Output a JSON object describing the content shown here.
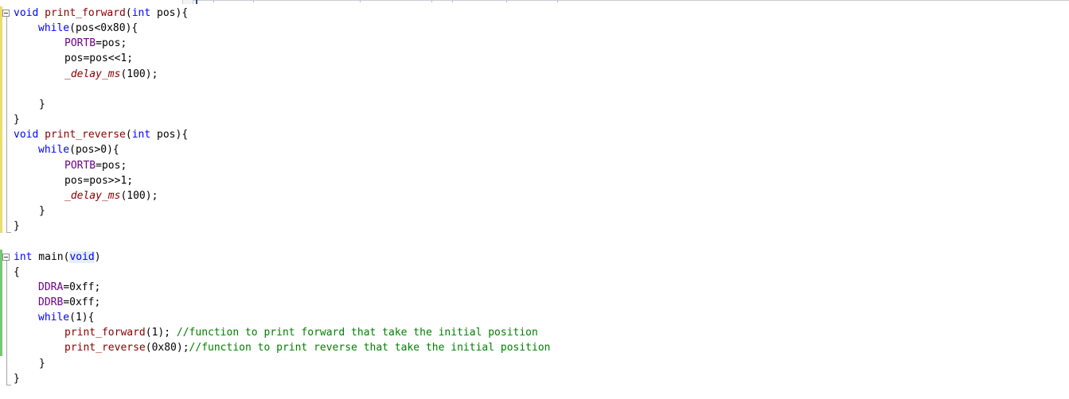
{
  "editor": {
    "fn_forward": {
      "sig_kw": "void",
      "sig_name": "print_forward",
      "sig_rest_open": "(",
      "sig_type": "int",
      "sig_param": " pos){",
      "while_kw": "while",
      "while_cond": "(pos<0x80){",
      "portb_name": "PORTB",
      "portb_rest": "=pos;",
      "shift_line": "pos=pos<<1;",
      "delay_name": "_delay_ms",
      "delay_args": "(100);",
      "close_inner": "}",
      "close_outer": "}"
    },
    "fn_reverse": {
      "sig_kw": "void",
      "sig_name": "print_reverse",
      "sig_rest_open": "(",
      "sig_type": "int",
      "sig_param": " pos){",
      "while_kw": "while",
      "while_cond": "(pos>0){",
      "portb_name": "PORTB",
      "portb_rest": "=pos;",
      "shift_line": "pos=pos>>1;",
      "delay_name": "_delay_ms",
      "delay_args": "(100);",
      "close_inner": "}",
      "close_outer": "}"
    },
    "fn_main": {
      "sig_type": "int",
      "sig_name": " main(",
      "sig_void": "void",
      "sig_close": ")",
      "open_brace": "{",
      "ddra_name": "DDRA",
      "ddra_rest": "=0xff;",
      "ddrb_name": "DDRB",
      "ddrb_rest": "=0xff;",
      "while_kw": "while",
      "while_cond": "(1){",
      "call_forward_name": "print_forward",
      "call_forward_args": "(1); ",
      "call_forward_comment": "//function to print forward that take the initial position",
      "call_reverse_name": "print_reverse",
      "call_reverse_args": "(0x80);",
      "call_reverse_comment": "//function to print reverse that take the initial position",
      "close_inner": "}",
      "close_outer": "}"
    }
  },
  "colors": {
    "keyword": "#0000ff",
    "function": "#880000",
    "macro": "#6f008a",
    "comment": "#008000",
    "change_saved": "#74c872",
    "change_unsaved": "#eedc6a"
  },
  "icons": {
    "fold": "collapse-minus-icon"
  }
}
